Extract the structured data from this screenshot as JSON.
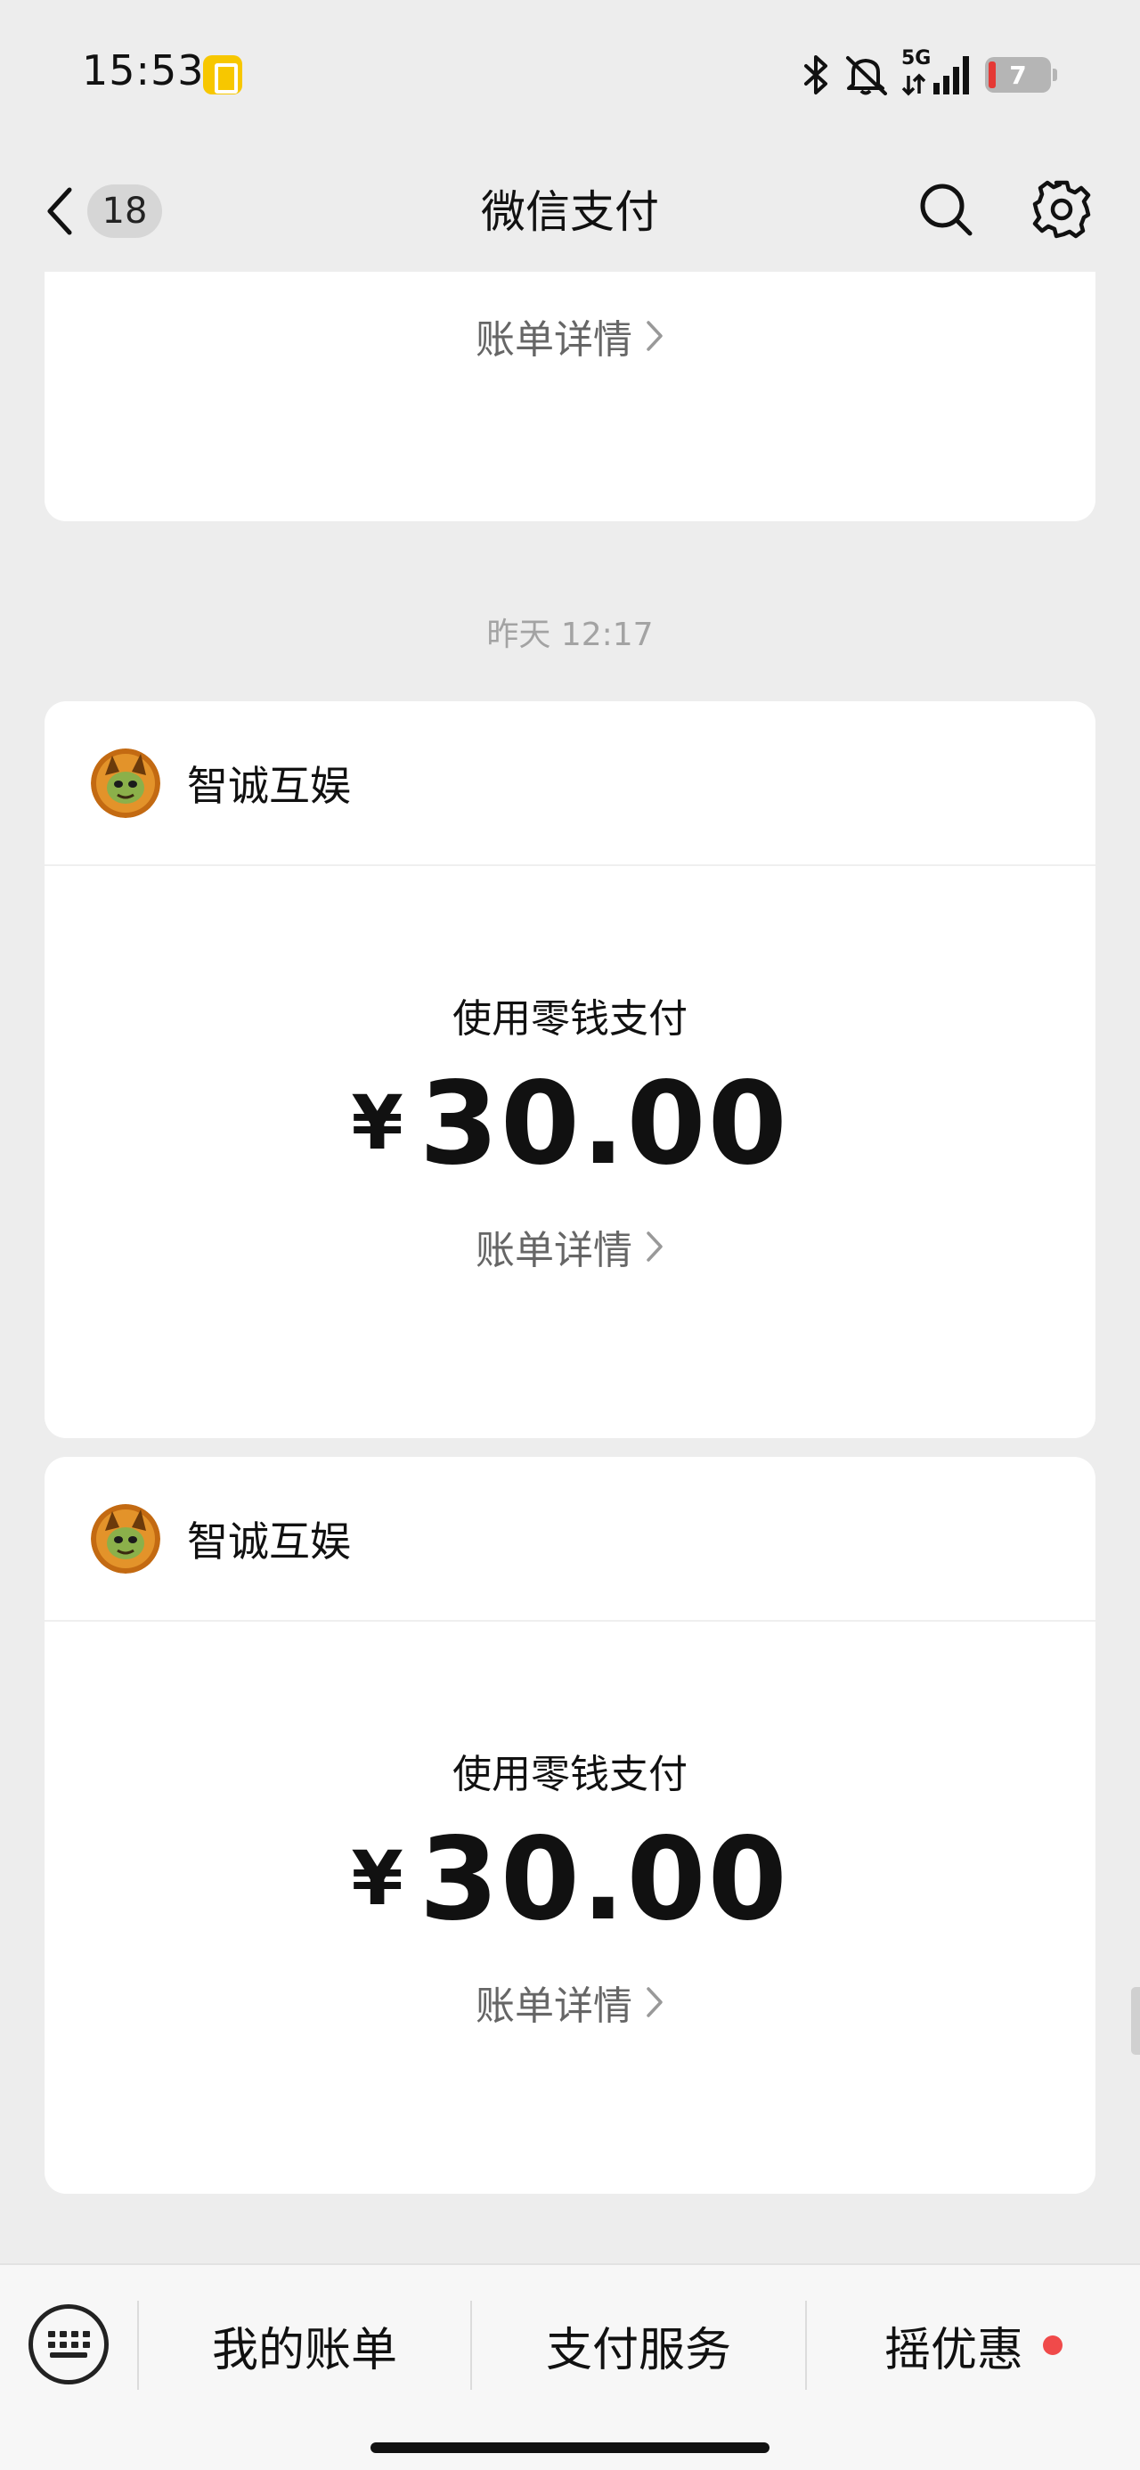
{
  "status_bar": {
    "time": "15:53",
    "network": "5G",
    "battery_level": "7",
    "icons": [
      "sim-icon",
      "bluetooth-icon",
      "mute-icon",
      "signal-icon",
      "battery-icon"
    ]
  },
  "nav": {
    "title": "微信支付",
    "unread_count": "18",
    "icons": [
      "back-icon",
      "search-icon",
      "settings-icon"
    ]
  },
  "messages": {
    "top_partial_detail": "账单详情",
    "timestamp": "昨天 12:17",
    "cards": [
      {
        "merchant": "智诚互娱",
        "pay_method": "使用零钱支付",
        "currency": "¥",
        "amount": "30.00",
        "detail_link": "账单详情"
      },
      {
        "merchant": "智诚互娱",
        "pay_method": "使用零钱支付",
        "currency": "¥",
        "amount": "30.00",
        "detail_link": "账单详情"
      }
    ]
  },
  "bottom_menu": {
    "items": [
      "我的账单",
      "支付服务",
      "摇优惠"
    ],
    "icons": [
      "keyboard-icon"
    ]
  },
  "colors": {
    "background": "#ededed",
    "card": "#ffffff",
    "badge_dot": "#f04a4a",
    "sim_badge": "#f7c700"
  }
}
